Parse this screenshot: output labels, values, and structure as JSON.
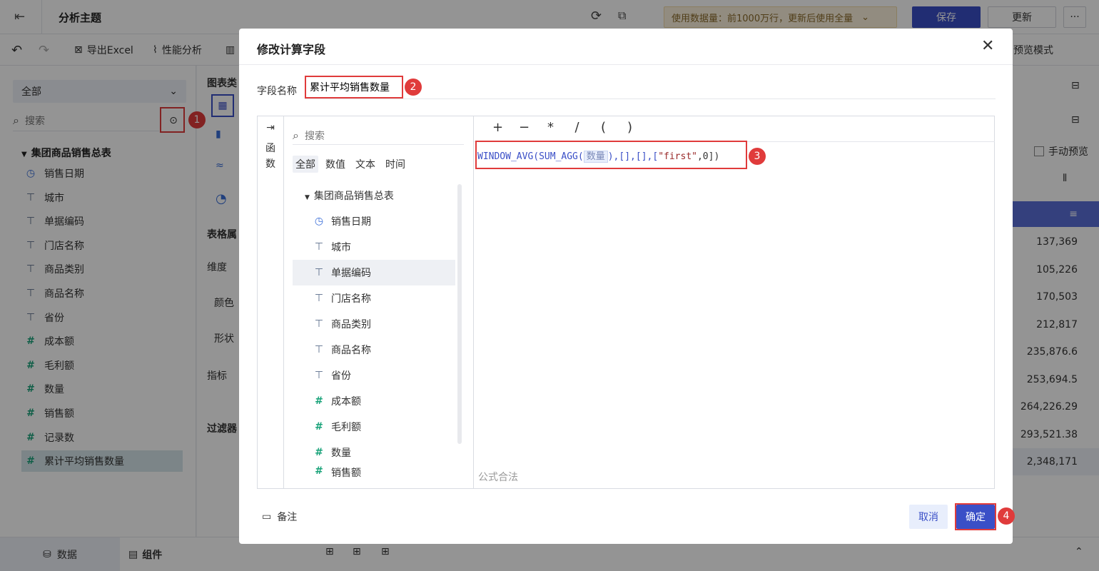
{
  "topbar": {
    "title": "分析主题",
    "usage_text": "使用数据量：前1000万行，更新后使用全量",
    "save_label": "保存",
    "update_label": "更新",
    "more_label": "···"
  },
  "toolbar": {
    "export_label": "导出Excel",
    "perf_label": "性能分析",
    "preview_mode_label": "预览模式"
  },
  "left_panel": {
    "dropdown_value": "全部",
    "search_placeholder": "搜索",
    "table_name": "集团商品销售总表",
    "fields": [
      {
        "label": "销售日期",
        "type": "date"
      },
      {
        "label": "城市",
        "type": "text"
      },
      {
        "label": "单据编码",
        "type": "text"
      },
      {
        "label": "门店名称",
        "type": "text"
      },
      {
        "label": "商品类别",
        "type": "text"
      },
      {
        "label": "商品名称",
        "type": "text"
      },
      {
        "label": "省份",
        "type": "text"
      },
      {
        "label": "成本额",
        "type": "number"
      },
      {
        "label": "毛利额",
        "type": "number"
      },
      {
        "label": "数量",
        "type": "number"
      },
      {
        "label": "销售额",
        "type": "number"
      },
      {
        "label": "记录数",
        "type": "number"
      },
      {
        "label": "累计平均销售数量",
        "type": "calc"
      }
    ]
  },
  "mid_panel": {
    "chart_type_label": "图表类",
    "table_attr_label": "表格属",
    "dimension_label": "维度",
    "color_label": "颜色",
    "shape_label": "形状",
    "metric_label": "指标",
    "filter_label": "过滤器"
  },
  "right_panel": {
    "manual_preview_label": "手动预览",
    "values": [
      "137,369",
      "105,226",
      "170,503",
      "212,817",
      "235,876.6",
      "253,694.5",
      "264,226.29",
      "293,521.38",
      "2,348,171"
    ]
  },
  "bottom_bar": {
    "data_tab": "数据",
    "component_tab": "组件"
  },
  "modal": {
    "title": "修改计算字段",
    "field_name_label": "字段名称",
    "field_name_value": "累计平均销售数量",
    "func_tab_label": "函数",
    "search_placeholder": "搜索",
    "filter_tabs": [
      "全部",
      "数值",
      "文本",
      "时间"
    ],
    "table_name": "集团商品销售总表",
    "fields": [
      {
        "label": "销售日期",
        "type": "date"
      },
      {
        "label": "城市",
        "type": "text"
      },
      {
        "label": "单据编码",
        "type": "text"
      },
      {
        "label": "门店名称",
        "type": "text"
      },
      {
        "label": "商品类别",
        "type": "text"
      },
      {
        "label": "商品名称",
        "type": "text"
      },
      {
        "label": "省份",
        "type": "text"
      },
      {
        "label": "成本额",
        "type": "number"
      },
      {
        "label": "毛利额",
        "type": "number"
      },
      {
        "label": "数量",
        "type": "number"
      },
      {
        "label": "销售额",
        "type": "number"
      }
    ],
    "operators": [
      "+",
      "−",
      "*",
      "/",
      "(",
      ")"
    ],
    "formula": {
      "part1": "WINDOW_AVG(SUM_AGG(",
      "field": "数量",
      "part2": "),[],[],[",
      "str": "\"first\"",
      "part3": ",0])"
    },
    "formula_status": "公式合法",
    "note_label": "备注",
    "cancel_label": "取消",
    "confirm_label": "确定"
  },
  "badges": [
    "1",
    "2",
    "3",
    "4"
  ],
  "colors": {
    "primary": "#3a4fc7",
    "highlight": "#e03b3b",
    "number_icon": "#1aa37a"
  }
}
